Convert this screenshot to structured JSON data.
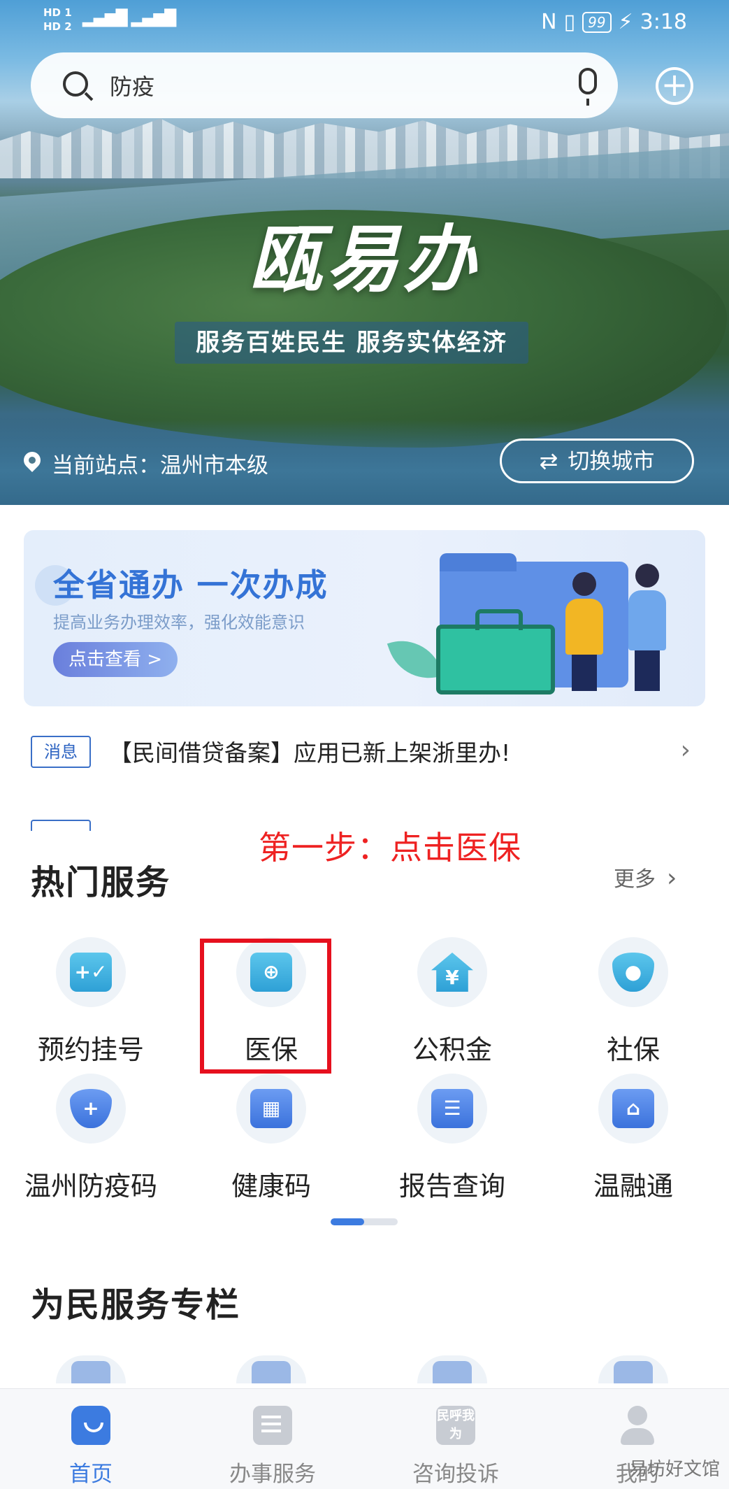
{
  "status_bar": {
    "left_hd1": "HD 1",
    "left_hd2": "HD 2",
    "signal": "5G 4G",
    "nfc": "N",
    "battery": "99",
    "time": "3:18"
  },
  "search": {
    "text": "防疫",
    "icon": "search-icon",
    "mic_icon": "mic-icon"
  },
  "add_icon": "plus-circle-icon",
  "hero": {
    "app_title": "瓯易办",
    "slogan": "服务百姓民生  服务实体经济",
    "site_label": "当前站点：温州市本级",
    "switch_city": "切换城市"
  },
  "promo": {
    "title": "全省通办 一次办成",
    "subtitle": "提高业务办理效率，强化效能意识",
    "button": "点击查看 >"
  },
  "news": {
    "tag": "消息",
    "text": "【民间借贷备案】应用已新上架浙里办!"
  },
  "annotation": {
    "step": "第一步：点击医保",
    "color": "#ee2222"
  },
  "hot_services": {
    "title": "热门服务",
    "more": "更多",
    "items": [
      {
        "label": "预约挂号",
        "icon": "calendar-icon"
      },
      {
        "label": "医保",
        "icon": "medical-kit-icon"
      },
      {
        "label": "公积金",
        "icon": "house-yuan-icon"
      },
      {
        "label": "社保",
        "icon": "shield-person-icon"
      },
      {
        "label": "温州防疫码",
        "icon": "shield-plus-icon"
      },
      {
        "label": "健康码",
        "icon": "qr-code-icon"
      },
      {
        "label": "报告查询",
        "icon": "report-icon"
      },
      {
        "label": "温融通",
        "icon": "finance-icon"
      }
    ]
  },
  "people_section": {
    "title": "为民服务专栏"
  },
  "tabbar": {
    "items": [
      {
        "label": "首页",
        "active": true
      },
      {
        "label": "办事服务",
        "active": false
      },
      {
        "label": "咨询投诉",
        "active": false,
        "icon_text": "民呼我为"
      },
      {
        "label": "我的",
        "active": false
      }
    ]
  },
  "watermark": "易坊好文馆",
  "colors": {
    "accent": "#3c7be0",
    "highlight": "#e6101e"
  }
}
